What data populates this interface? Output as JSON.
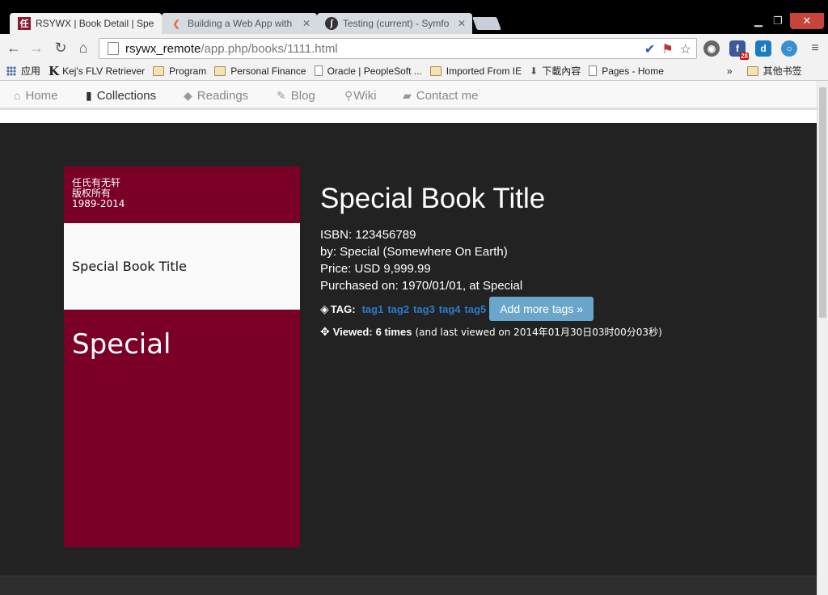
{
  "browser": {
    "tabs": [
      {
        "label": "RSYWX | Book Detail | Spe",
        "favicon": "任",
        "active": true
      },
      {
        "label": "Building a Web App with",
        "active": false
      },
      {
        "label": "Testing (current) - Symfo",
        "active": false
      }
    ],
    "url_host": "rsywx_remote",
    "url_path": "/app.php/books/1111.html",
    "bookmarks": [
      {
        "label": "应用"
      },
      {
        "label": "Kej's FLV Retriever",
        "icon_letter": "K"
      },
      {
        "label": "Program"
      },
      {
        "label": "Personal Finance"
      },
      {
        "label": "Oracle | PeopleSoft ..."
      },
      {
        "label": "Imported From IE"
      },
      {
        "label": "下載內容"
      },
      {
        "label": "Pages - Home"
      },
      {
        "label": "»"
      },
      {
        "label": "其他书签"
      }
    ],
    "extension_badge": "28"
  },
  "nav": {
    "items": [
      {
        "label": "Home",
        "icon": "home-icon"
      },
      {
        "label": "Collections",
        "icon": "book-icon"
      },
      {
        "label": "Readings",
        "icon": "tags-icon"
      },
      {
        "label": "Blog",
        "icon": "pencil-icon"
      },
      {
        "label": "Wiki",
        "icon": "search-icon"
      },
      {
        "label": "Contact me",
        "icon": "comment-icon"
      }
    ],
    "active": "Collections"
  },
  "cover": {
    "copyright_line1": "任氏有无轩",
    "copyright_line2": "版权所有",
    "copyright_line3": "1989-2014",
    "title": "Special Book Title",
    "author": "Special"
  },
  "book": {
    "title": "Special Book Title",
    "isbn": "ISBN: 123456789",
    "by": "by: Special (Somewhere On Earth)",
    "price": "Price: USD 9,999.99",
    "purchased": "Purchased on: 1970/01/01, at Special",
    "tag_label": "TAG:",
    "tags": [
      "tag1",
      "tag2",
      "tag3",
      "tag4",
      "tag5"
    ],
    "add_tags_label": "Add more tags »",
    "viewed_label": "Viewed:",
    "viewed_count": "6 times",
    "viewed_note": "(and last viewed on 2014年01月30日03时00分03秒)"
  },
  "colors": {
    "cover": "#7a0026",
    "page_bg": "#222222",
    "tag_link": "#2a7bcc",
    "button": "#6aa6c9"
  }
}
